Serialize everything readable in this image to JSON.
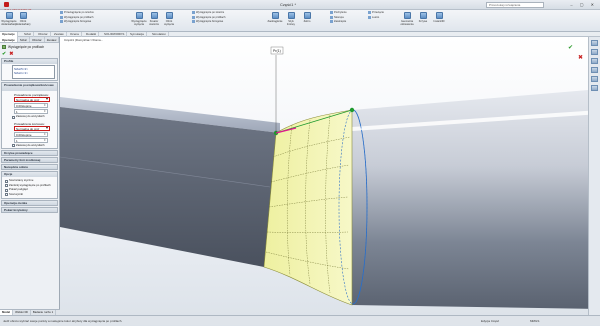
{
  "app": {
    "logo_text": "SOLIDWORKS",
    "window_title": "Część1 *",
    "search_placeholder": "Przeszukaj rozwiązania",
    "window_buttons": "‒ ▢ ✕"
  },
  "ribbon": {
    "big_buttons": [
      {
        "label": "Wyciągnięcie dodania/bazy",
        "icon": "extrude-icon"
      },
      {
        "label": "Obrót dodania/bazy",
        "icon": "revolve-icon"
      },
      {
        "label": "Wyciągnięcie wycięcia",
        "icon": "extruded-cut-icon"
      },
      {
        "label": "Kreator otworów",
        "icon": "hole-wizard-icon"
      },
      {
        "label": "Obrót wycięcia",
        "icon": "revolved-cut-icon"
      },
      {
        "label": "Zaokrąglenie",
        "icon": "fillet-icon"
      },
      {
        "label": "Szyk liniowy",
        "icon": "linear-pattern-icon"
      },
      {
        "label": "Żebro",
        "icon": "rib-icon"
      },
      {
        "label": "Geometria odniesienia",
        "icon": "reference-geometry-icon"
      },
      {
        "label": "Krzywe",
        "icon": "curves-icon"
      },
      {
        "label": "Instant3D",
        "icon": "instant3d-icon"
      }
    ],
    "list_col_1": [
      "Przeciągnięcie po ścieżce",
      "Wyciągnięcie po profilach",
      "Wyciągnięcie brzegowe"
    ],
    "list_col_2": [
      "Wyciągnięcie po ścieżce",
      "Wyciągnięcie po profilach",
      "Wyciągnięcie brzegowe"
    ],
    "list_col_3": [
      "Pochylenie",
      "Skorupa",
      "Zawinięcie",
      "Przecięcie",
      "Lustro"
    ]
  },
  "command_tabs": [
    "Operacje",
    "Szkic",
    "Obszar",
    "Zestaw",
    "Ocena",
    "Dodatki",
    "SOLIDWORKS",
    "Symulacja",
    "Simulation"
  ],
  "panel": {
    "tabs": [
      "Operacje",
      "Szkic",
      "Obszar",
      "Zestaw"
    ],
    "feature_title": "Wyciągnięcie po profilach",
    "profiles_header": "Profile",
    "profiles": [
      "Szkic5<2>",
      "Szkic1<1>"
    ],
    "constraints_header": "Prowadzenie początkowe/końcowe",
    "start_constraint_label": "Prowadzenie początkowe:",
    "start_constraint_value": "Normalna do prof",
    "start_draft_value": "0.00stopnie",
    "start_tangent_value": "1",
    "start_apply_all": "Zastosuj do wszystkich",
    "end_constraint_label": "Prowadzenie końcowe:",
    "end_constraint_value": "Normalna do prof",
    "end_draft_value": "0.00stopnie",
    "end_tangent_value": "1",
    "end_apply_all": "Zastosuj do wszystkich",
    "guide_curves": "Krzywe prowadzące",
    "centerline": "Parametry linii środkowej",
    "sketch_tools": "Narzędzia szkicu",
    "options_header": "Opcje",
    "merge_tangent": "Scal ściany styczne",
    "close_loft": "Zamknij wyciągnięcie po profilach",
    "show_preview": "Pokaż podgląd",
    "merge_result": "Scal wyniki",
    "thin_feature": "Operacja cienka",
    "curvature_display": "Pokaż krzywizny"
  },
  "bottom_tabs": [
    "Model",
    "Widoki 3D",
    "Badanie ruchu 1"
  ],
  "viewport": {
    "breadcrumb": "Część1 (Domyślna<<Doma...",
    "callout_label": "Pr(1)"
  },
  "status": {
    "message": "Jedź obrotu wybrać swoje punkty a następnie kolor  atrybuty dla wyciągnięcia po profilach.",
    "editing": "Edycja Część",
    "units": "MMGS"
  },
  "colors": {
    "accent_red": "#c81818",
    "loft_surface": "#f4f5a8",
    "selection_green": "#1f9a2e",
    "connector_magenta": "#e0168e"
  }
}
